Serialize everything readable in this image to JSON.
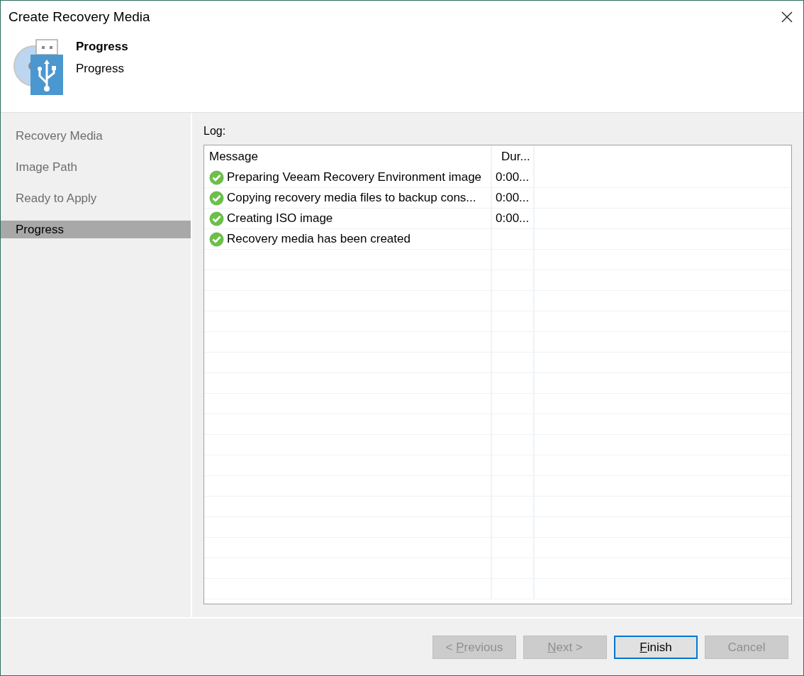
{
  "window": {
    "title": "Create Recovery Media"
  },
  "header": {
    "title": "Progress",
    "subtitle": "Progress"
  },
  "steps": [
    {
      "label": "Recovery Media",
      "selected": false
    },
    {
      "label": "Image Path",
      "selected": false
    },
    {
      "label": "Ready to Apply",
      "selected": false
    },
    {
      "label": "Progress",
      "selected": true
    }
  ],
  "log": {
    "label": "Log:",
    "columns": [
      "Message",
      "Dur..."
    ],
    "rows": [
      {
        "kind": "success",
        "message": "Preparing Veeam Recovery Environment image",
        "duration": "0:00..."
      },
      {
        "kind": "success",
        "message": "Copying recovery media files to backup cons...",
        "duration": "0:00..."
      },
      {
        "kind": "success",
        "message": "Creating ISO image",
        "duration": "0:00..."
      },
      {
        "kind": "success",
        "message": "Recovery media has been created"
      }
    ]
  },
  "buttons": [
    {
      "label": [
        {
          "text": "< ",
          "underlined": false
        },
        {
          "text": "P",
          "underlined": true
        },
        {
          "text": "revious",
          "underlined": false
        }
      ],
      "disabled": true,
      "focused": false
    },
    {
      "label": [
        {
          "text": "N",
          "underlined": true
        },
        {
          "text": "ext >",
          "underlined": false
        }
      ],
      "disabled": true,
      "focused": false
    },
    {
      "label": [
        {
          "text": "F",
          "underlined": true
        },
        {
          "text": "inish",
          "underlined": false
        }
      ],
      "disabled": false,
      "focused": true
    },
    {
      "label": [
        {
          "text": "Cancel",
          "underlined": false
        }
      ],
      "disabled": true,
      "focused": false
    }
  ]
}
